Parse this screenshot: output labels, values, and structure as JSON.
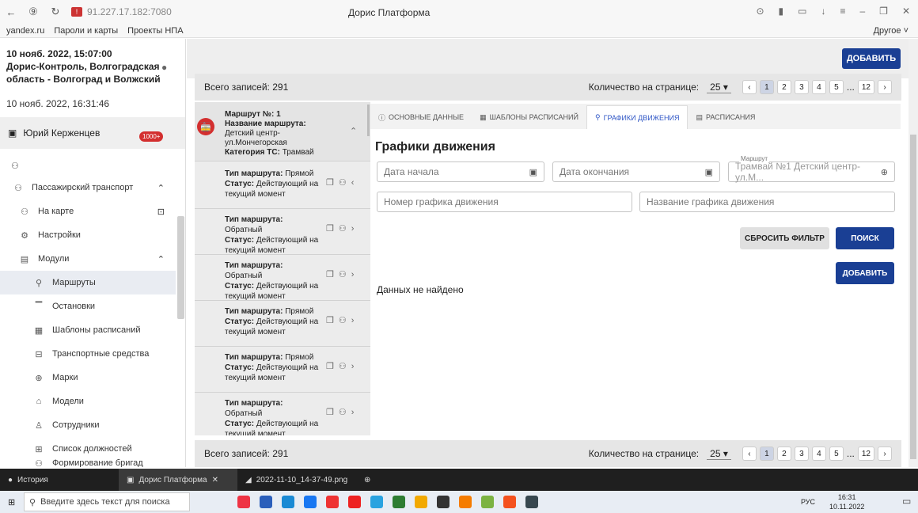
{
  "browser": {
    "address": "91.227.17.182:7080",
    "title": "Дорис Платформа",
    "bookmarks": [
      "yandex.ru",
      "Пароли и карты",
      "Проекты НПА"
    ],
    "other_bookmarks": "Другое ˅"
  },
  "left": {
    "date1": "10 нояб. 2022, 15:07:00",
    "location": "Дорис-Контроль, Волгоградская область - Волгоград и Волжский",
    "date2": "10 нояб. 2022, 16:31:46",
    "user": "Юрий Керженцев",
    "badge": "1000+",
    "nav": [
      {
        "label": "Пассажирский транспорт",
        "icon": "people-group-icon"
      },
      {
        "label": "На карте",
        "icon": "map-group-icon"
      },
      {
        "label": "Настройки",
        "icon": "settings-icon"
      },
      {
        "label": "Модули",
        "icon": "modules-icon"
      },
      {
        "label": "Маршруты",
        "icon": "route-icon"
      },
      {
        "label": "Остановки",
        "icon": "stop-icon"
      },
      {
        "label": "Шаблоны расписаний",
        "icon": "table-icon"
      },
      {
        "label": "Транспортные средства",
        "icon": "bus-icon"
      },
      {
        "label": "Марки",
        "icon": "brand-icon"
      },
      {
        "label": "Модели",
        "icon": "car-icon"
      },
      {
        "label": "Сотрудники",
        "icon": "person-icon"
      },
      {
        "label": "Список должностей",
        "icon": "briefcase-icon"
      },
      {
        "label": "Формирование бригад",
        "icon": "team-icon"
      }
    ]
  },
  "header": {
    "add_label": "ДОБАВИТЬ",
    "total": "Всего записей: 291",
    "per_page_label": "Количество на странице:",
    "per_page": "25",
    "pages": [
      "1",
      "2",
      "3",
      "4",
      "5",
      "...",
      "12"
    ]
  },
  "route": {
    "num_label": "Маршрут №:",
    "num": "1",
    "name_label": "Название маршрута:",
    "name": "Детский центр-ул.Мончегорская",
    "cat_label": "Категория ТС:",
    "cat": "Трамвай"
  },
  "variants": [
    {
      "type_label": "Тип маршрута:",
      "type": "Прямой",
      "status_label": "Статус:",
      "status": "Действующий на текущий момент"
    },
    {
      "type_label": "Тип маршрута:",
      "type": "Обратный",
      "status_label": "Статус:",
      "status": "Действующий на текущий момент"
    },
    {
      "type_label": "Тип маршрута:",
      "type": "Обратный",
      "status_label": "Статус:",
      "status": "Действующий на текущий момент"
    },
    {
      "type_label": "Тип маршрута:",
      "type": "Прямой",
      "status_label": "Статус:",
      "status": "Действующий на текущий момент"
    },
    {
      "type_label": "Тип маршрута:",
      "type": "Прямой",
      "status_label": "Статус:",
      "status": "Действующий на текущий момент"
    },
    {
      "type_label": "Тип маршрута:",
      "type": "Обратный",
      "status_label": "Статус:",
      "status": "Действующий на текущий момент"
    }
  ],
  "tabs": [
    "ОСНОВНЫЕ ДАННЫЕ",
    "ШАБЛОНЫ РАСПИСАНИЙ",
    "ГРАФИКИ ДВИЖЕНИЯ",
    "РАСПИСАНИЯ"
  ],
  "main": {
    "title": "Графики движения",
    "date_start": "Дата начала",
    "date_end": "Дата окончания",
    "route_label": "Маршрут",
    "route_value": "Трамвай №1 Детский центр-ул.М...",
    "sched_num": "Номер графика движения",
    "sched_name": "Название графика движения",
    "reset": "СБРОСИТЬ ФИЛЬТР",
    "search": "ПОИСК",
    "add": "ДОБАВИТЬ",
    "nodata": "Данных не найдено"
  },
  "taskstrip": {
    "history": "История",
    "tab1": "Дорис Платформа",
    "tab2": "2022-11-10_14-37-49.png"
  },
  "taskbar": {
    "search": "Введите здесь текст для поиска",
    "lang": "РУС",
    "time": "16:31",
    "date": "10.11.2022"
  },
  "colors": {
    "accent": "#1a3f94",
    "badge": "#d32f2f",
    "tab_active": "#2f56c6"
  }
}
